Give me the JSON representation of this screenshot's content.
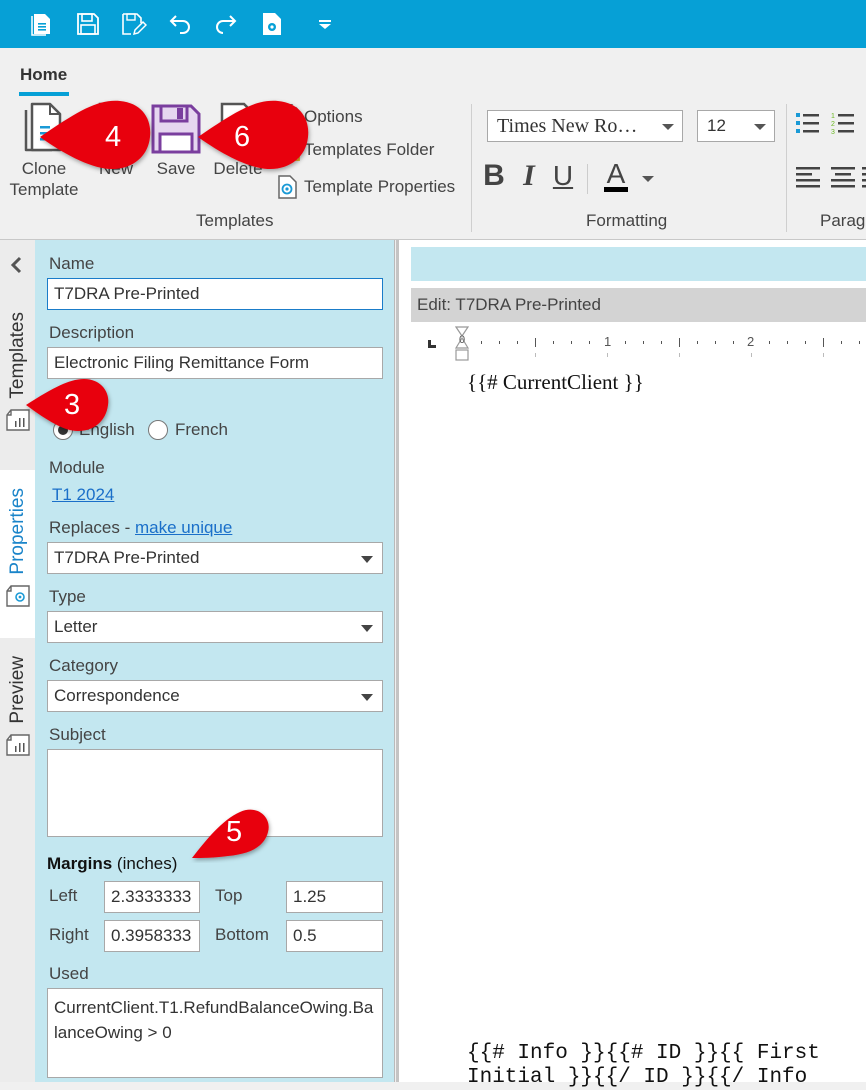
{
  "quick_access": {
    "buttons": [
      {
        "name": "new-document",
        "icon": "document-icon"
      },
      {
        "name": "save",
        "icon": "save-icon"
      },
      {
        "name": "save-as",
        "icon": "save-edit-icon"
      },
      {
        "name": "undo",
        "icon": "undo-icon"
      },
      {
        "name": "redo",
        "icon": "redo-icon"
      },
      {
        "name": "document-settings",
        "icon": "document-gear-icon"
      },
      {
        "name": "customize",
        "icon": "dropdown-icon"
      }
    ]
  },
  "ribbon": {
    "active_tab": "Home",
    "groups": {
      "templates": {
        "label": "Templates",
        "clone_line1": "Clone",
        "clone_line2": "Template",
        "new": "New",
        "save": "Save",
        "delete": "Delete",
        "options": "Options",
        "templates_folder": "Templates Folder",
        "template_properties": "Template Properties"
      },
      "formatting": {
        "label": "Formatting",
        "font": "Times New Ro…",
        "size": "12",
        "bold": "B",
        "italic": "I",
        "underline": "U",
        "font_color": "A"
      },
      "paragraph": {
        "label": "Parag"
      }
    }
  },
  "side_tabs": {
    "collapse": "<",
    "items": [
      {
        "label": "Templates",
        "selected": false
      },
      {
        "label": "Properties",
        "selected": true
      },
      {
        "label": "Preview",
        "selected": false
      }
    ]
  },
  "properties": {
    "name_label": "Name",
    "name_value": "T7DRA Pre-Printed",
    "description_label": "Description",
    "description_value": "Electronic Filing Remittance Form",
    "language_options": [
      "English",
      "French"
    ],
    "language_selected": "English",
    "module_label": "Module",
    "module_link": "T1 2024",
    "replaces_label": "Replaces -",
    "replaces_link": "make unique",
    "replaces_value": "T7DRA Pre-Printed",
    "type_label": "Type",
    "type_value": "Letter",
    "category_label": "Category",
    "category_value": "Correspondence",
    "subject_label": "Subject",
    "subject_value": "",
    "margins_label": "Margins",
    "margins_unit": "(inches)",
    "left_label": "Left",
    "left_value": "2.3333333",
    "top_label": "Top",
    "top_value": "1.25",
    "right_label": "Right",
    "right_value": "0.3958333",
    "bottom_label": "Bottom",
    "bottom_value": "0.5",
    "used_label": "Used",
    "used_value": "CurrentClient.T1.RefundBalanceOwing.BalanceOwing > 0"
  },
  "editor": {
    "title": "Edit: T7DRA Pre-Printed",
    "ruler_labels": [
      "0",
      "1",
      "2"
    ],
    "line1": "{{# CurrentClient }}",
    "bottom_line1": "{{# Info }}{{# ID }}{{ First",
    "bottom_line2": "Initial }}{{/ ID }}{{/ Info"
  },
  "annotations": [
    "3",
    "4",
    "5",
    "6"
  ],
  "colors": {
    "accent": "#06a0d6",
    "panel": "#c3e7f0",
    "callout": "#e8000b",
    "link": "#1a6fc9",
    "save_purple": "#7a3e9e"
  }
}
